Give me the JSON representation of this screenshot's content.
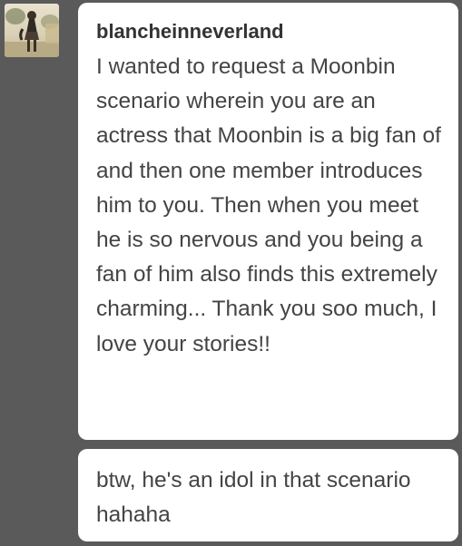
{
  "conversation": {
    "avatar": {
      "icon": "user-avatar-photo"
    },
    "messages": [
      {
        "username": "blancheinneverland",
        "text": "I wanted to request a Moonbin scenario wherein you are an actress that Moonbin is a big fan of and then one member introduces him to you. Then when you meet he is so nervous and you being a fan of him also finds this extremely charming... Thank you soo much, I love your stories!!"
      },
      {
        "text": "btw, he's an idol in that scenario hahaha"
      }
    ]
  },
  "colors": {
    "background": "#5a5a5a",
    "bubble": "#ffffff",
    "text": "#444444"
  }
}
